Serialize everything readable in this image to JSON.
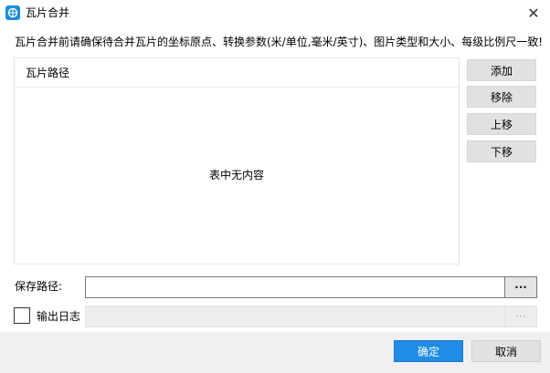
{
  "window": {
    "title": "瓦片合并",
    "close_icon": "close-icon",
    "app_icon": "tile-merge-icon"
  },
  "notice": "瓦片合并前请确保待合并瓦片的坐标原点、转换参数(米/单位,毫米/英寸)、图片类型和大小、每级比例尺一致!",
  "table": {
    "columns": [
      "瓦片路径"
    ],
    "rows": [],
    "empty_text": "表中无内容"
  },
  "side_buttons": {
    "add": "添加",
    "remove": "移除",
    "move_up": "上移",
    "move_down": "下移"
  },
  "save": {
    "label": "保存路径:",
    "value": "",
    "browse": "···"
  },
  "log": {
    "label": "输出日志",
    "checked": false,
    "value": "",
    "browse": "···"
  },
  "footer": {
    "ok": "确定",
    "cancel": "取消"
  },
  "colors": {
    "accent": "#1f8ce6",
    "footer_bg": "#f0f0f0"
  }
}
